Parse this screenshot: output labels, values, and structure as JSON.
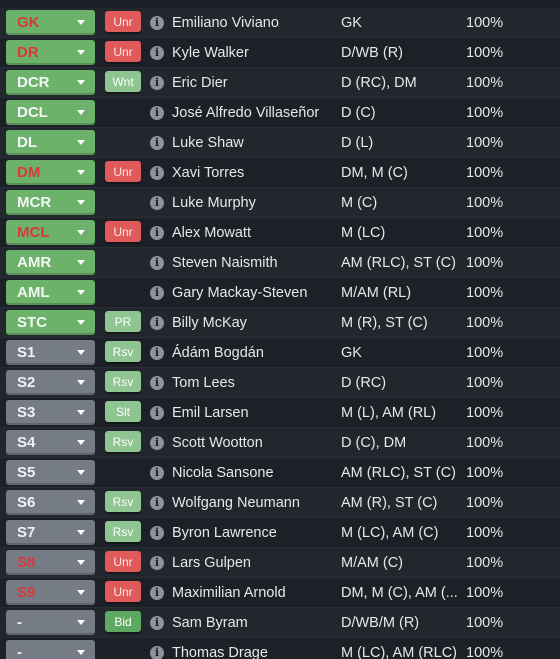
{
  "rows": [
    {
      "position": "GK",
      "select_style": "green",
      "red_text": true,
      "badge": "Unr",
      "badge_style": "unr",
      "name": "Emiliano Viviano",
      "positions": "GK",
      "percent": "100%"
    },
    {
      "position": "DR",
      "select_style": "green",
      "red_text": true,
      "badge": "Unr",
      "badge_style": "unr",
      "name": "Kyle Walker",
      "positions": "D/WB (R)",
      "percent": "100%"
    },
    {
      "position": "DCR",
      "select_style": "green",
      "red_text": false,
      "badge": "Wnt",
      "badge_style": "pale",
      "name": "Eric Dier",
      "positions": "D (RC), DM",
      "percent": "100%"
    },
    {
      "position": "DCL",
      "select_style": "green",
      "red_text": false,
      "badge": "",
      "badge_style": "",
      "name": "José Alfredo Villaseñor",
      "positions": "D (C)",
      "percent": "100%"
    },
    {
      "position": "DL",
      "select_style": "green",
      "red_text": false,
      "badge": "",
      "badge_style": "",
      "name": "Luke Shaw",
      "positions": "D (L)",
      "percent": "100%"
    },
    {
      "position": "DM",
      "select_style": "green",
      "red_text": true,
      "badge": "Unr",
      "badge_style": "unr",
      "name": "Xavi Torres",
      "positions": "DM, M (C)",
      "percent": "100%"
    },
    {
      "position": "MCR",
      "select_style": "green",
      "red_text": false,
      "badge": "",
      "badge_style": "",
      "name": "Luke Murphy",
      "positions": "M (C)",
      "percent": "100%"
    },
    {
      "position": "MCL",
      "select_style": "green",
      "red_text": true,
      "badge": "Unr",
      "badge_style": "unr",
      "name": "Alex Mowatt",
      "positions": "M (LC)",
      "percent": "100%"
    },
    {
      "position": "AMR",
      "select_style": "green",
      "red_text": false,
      "badge": "",
      "badge_style": "",
      "name": "Steven Naismith",
      "positions": "AM (RLC), ST (C)",
      "percent": "100%"
    },
    {
      "position": "AML",
      "select_style": "green",
      "red_text": false,
      "badge": "",
      "badge_style": "",
      "name": "Gary Mackay-Steven",
      "positions": "M/AM (RL)",
      "percent": "100%"
    },
    {
      "position": "STC",
      "select_style": "green",
      "red_text": false,
      "badge": "PR",
      "badge_style": "pale",
      "name": "Billy McKay",
      "positions": "M (R), ST (C)",
      "percent": "100%"
    },
    {
      "position": "S1",
      "select_style": "grey",
      "red_text": false,
      "badge": "Rsv",
      "badge_style": "pale",
      "name": "Ádám Bogdán",
      "positions": "GK",
      "percent": "100%"
    },
    {
      "position": "S2",
      "select_style": "grey",
      "red_text": false,
      "badge": "Rsv",
      "badge_style": "pale",
      "name": "Tom Lees",
      "positions": "D (RC)",
      "percent": "100%"
    },
    {
      "position": "S3",
      "select_style": "grey",
      "red_text": false,
      "badge": "Slt",
      "badge_style": "pale",
      "name": "Emil Larsen",
      "positions": "M (L), AM (RL)",
      "percent": "100%"
    },
    {
      "position": "S4",
      "select_style": "grey",
      "red_text": false,
      "badge": "Rsv",
      "badge_style": "pale",
      "name": "Scott Wootton",
      "positions": "D (C), DM",
      "percent": "100%"
    },
    {
      "position": "S5",
      "select_style": "grey",
      "red_text": false,
      "badge": "",
      "badge_style": "",
      "name": "Nicola Sansone",
      "positions": "AM (RLC), ST (C)",
      "percent": "100%"
    },
    {
      "position": "S6",
      "select_style": "grey",
      "red_text": false,
      "badge": "Rsv",
      "badge_style": "pale",
      "name": "Wolfgang Neumann",
      "positions": "AM (R), ST (C)",
      "percent": "100%"
    },
    {
      "position": "S7",
      "select_style": "grey",
      "red_text": false,
      "badge": "Rsv",
      "badge_style": "pale",
      "name": "Byron Lawrence",
      "positions": "M (LC), AM (C)",
      "percent": "100%"
    },
    {
      "position": "S8",
      "select_style": "grey",
      "red_text": true,
      "badge": "Unr",
      "badge_style": "unr",
      "name": "Lars Gulpen",
      "positions": "M/AM (C)",
      "percent": "100%"
    },
    {
      "position": "S9",
      "select_style": "grey",
      "red_text": true,
      "badge": "Unr",
      "badge_style": "unr",
      "name": "Maximilian Arnold",
      "positions": "DM, M (C), AM (...",
      "percent": "100%"
    },
    {
      "position": "-",
      "select_style": "grey",
      "red_text": false,
      "badge": "Bid",
      "badge_style": "bid",
      "name": "Sam Byram",
      "positions": "D/WB/M (R)",
      "percent": "100%"
    },
    {
      "position": "-",
      "select_style": "grey",
      "red_text": false,
      "badge": "",
      "badge_style": "",
      "name": "Thomas Drage",
      "positions": "M (LC), AM (RLC)",
      "percent": "100%"
    }
  ],
  "icons": {
    "info": "info-icon",
    "dropdown": "chevron-down-icon"
  },
  "colors": {
    "green_select": "#6cb26b",
    "grey_select": "#767c86",
    "red_text": "#d83a3a",
    "unr_badge": "#e15a5a",
    "pale_badge": "#8ec591"
  }
}
